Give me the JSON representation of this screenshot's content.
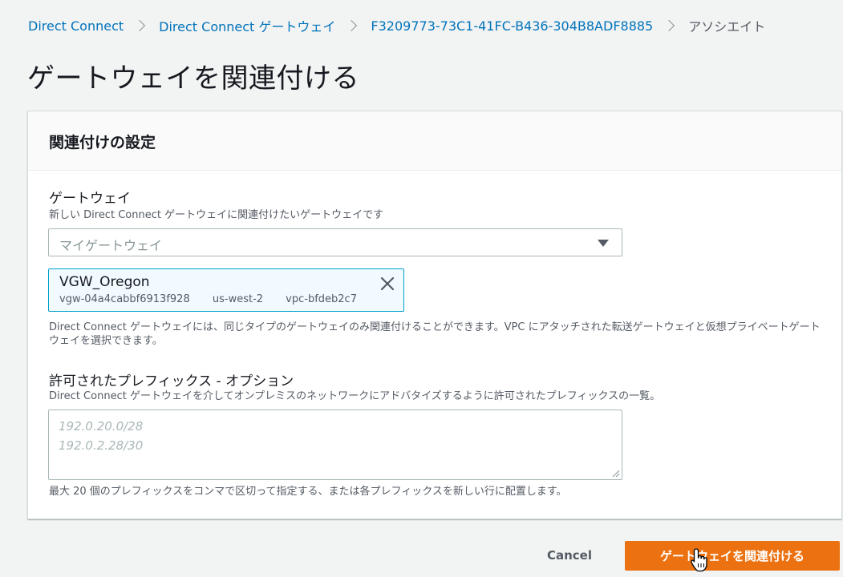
{
  "breadcrumb": {
    "items": [
      {
        "label": "Direct Connect"
      },
      {
        "label": "Direct Connect ゲートウェイ"
      },
      {
        "label": "F3209773-73C1-41FC-B436-304B8ADF8885"
      }
    ],
    "current": "アソシエイト"
  },
  "page_title": "ゲートウェイを関連付ける",
  "card": {
    "header": "関連付けの設定",
    "gateway_field": {
      "label": "ゲートウェイ",
      "description": "新しい Direct Connect ゲートウェイに関連付けたいゲートウェイです",
      "placeholder": "マイゲートウェイ",
      "selected_token": {
        "name": "VGW_Oregon",
        "id": "vgw-04a4cabbf6913f928",
        "region": "us-west-2",
        "vpc": "vpc-bfdeb2c7"
      },
      "help": "Direct Connect ゲートウェイには、同じタイプのゲートウェイのみ関連付けることができます。VPC にアタッチされた転送ゲートウェイと仮想プライベートゲートウェイを選択できます。"
    },
    "prefix_field": {
      "label": "許可されたプレフィックス - オプション",
      "description": "Direct Connect ゲートウェイを介してオンプレミスのネットワークにアドバタイズするように許可されたプレフィックスの一覧。",
      "placeholder_lines": [
        "192.0.20.0/28",
        "192.0.2.28/30"
      ],
      "help": "最大 20 個のプレフィックスをコンマで区切って指定する、または各プレフィックスを新しい行に配置します。"
    }
  },
  "footer": {
    "cancel_label": "Cancel",
    "submit_label": "ゲートウェイを関連付ける"
  },
  "colors": {
    "link": "#0073bb",
    "primary": "#ec7211",
    "token_border": "#00a1c9",
    "token_bg": "#f1faff"
  },
  "icons": {
    "breadcrumb_separator": "chevron-right-icon",
    "select_caret": "caret-down-icon",
    "token_remove": "close-icon",
    "textarea_resize": "resize-grip-icon",
    "pointer": "hand-cursor-icon"
  }
}
